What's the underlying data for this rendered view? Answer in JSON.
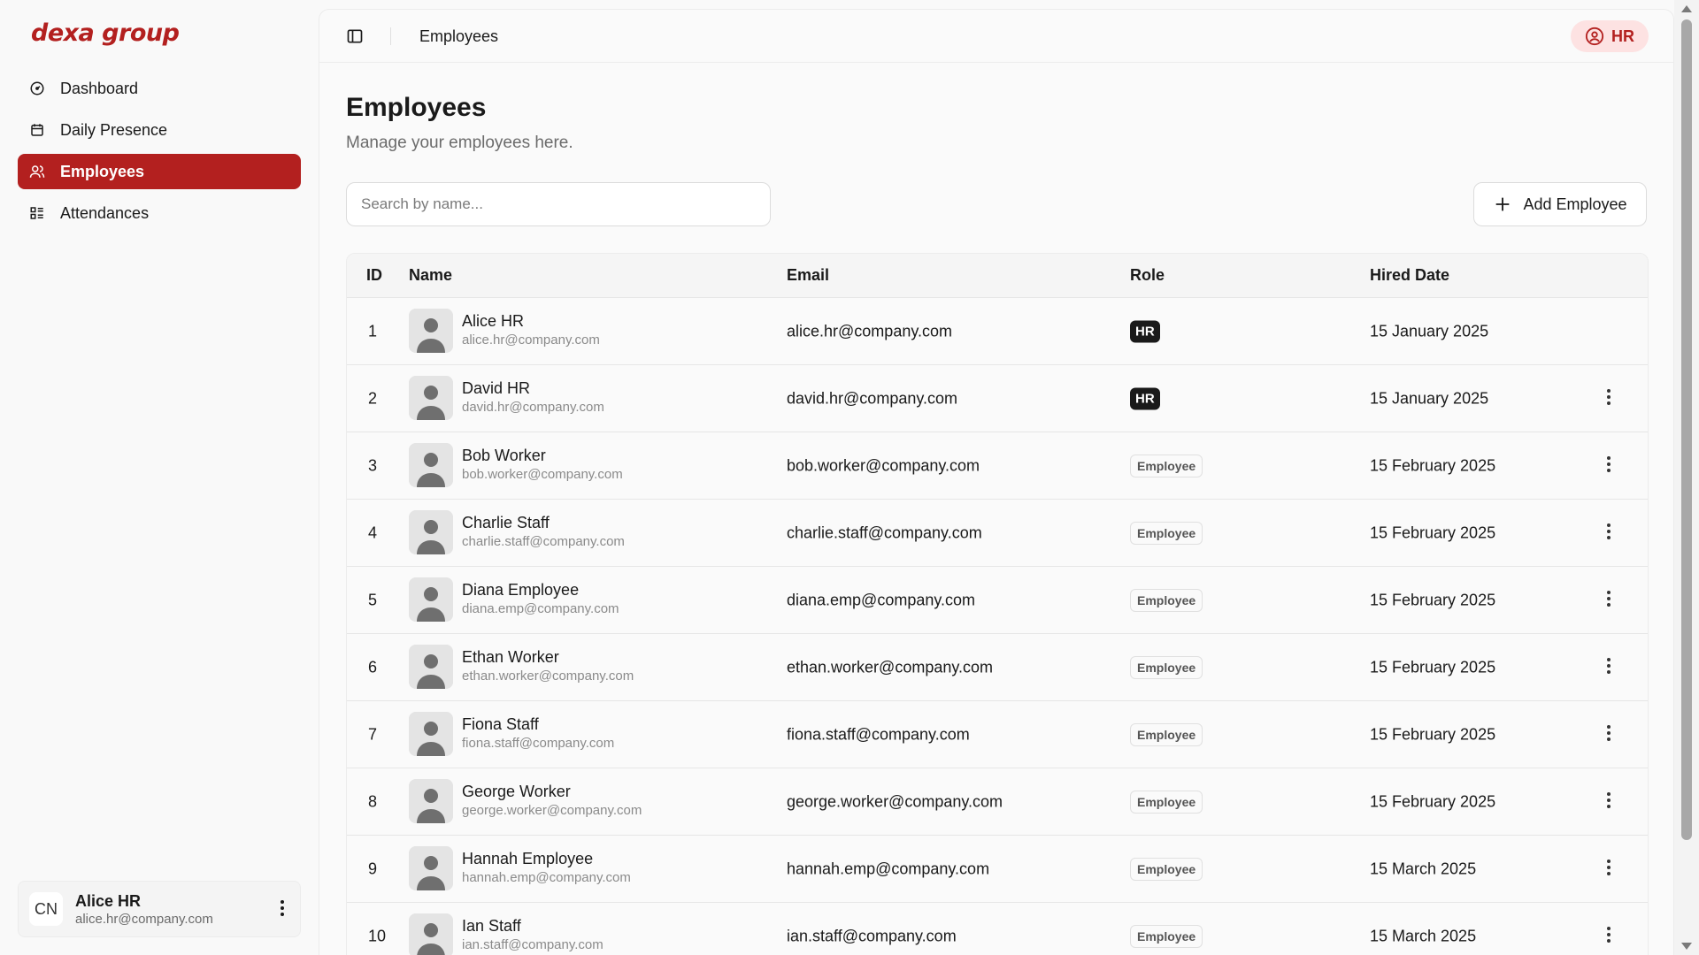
{
  "brand": {
    "logo": "dexa group",
    "accent": "#b3201f"
  },
  "sidebar": {
    "items": [
      {
        "label": "Dashboard",
        "icon": "dashboard-icon",
        "active": false
      },
      {
        "label": "Daily Presence",
        "icon": "calendar-icon",
        "active": false
      },
      {
        "label": "Employees",
        "icon": "users-icon",
        "active": true
      },
      {
        "label": "Attendances",
        "icon": "list-icon",
        "active": false
      }
    ],
    "user": {
      "initials": "CN",
      "name": "Alice HR",
      "email": "alice.hr@company.com"
    }
  },
  "header": {
    "breadcrumb": "Employees",
    "role_badge": "HR"
  },
  "page": {
    "title": "Employees",
    "subtitle": "Manage your employees here.",
    "search_placeholder": "Search by name...",
    "add_button": "Add Employee"
  },
  "table": {
    "columns": [
      "ID",
      "Name",
      "Email",
      "Role",
      "Hired Date"
    ],
    "rows": [
      {
        "id": "1",
        "name": "Alice HR",
        "sub": "alice.hr@company.com",
        "email": "alice.hr@company.com",
        "role": "HR",
        "date": "15 January 2025"
      },
      {
        "id": "2",
        "name": "David HR",
        "sub": "david.hr@company.com",
        "email": "david.hr@company.com",
        "role": "HR",
        "date": "15 January 2025"
      },
      {
        "id": "3",
        "name": "Bob Worker",
        "sub": "bob.worker@company.com",
        "email": "bob.worker@company.com",
        "role": "Employee",
        "date": "15 February 2025"
      },
      {
        "id": "4",
        "name": "Charlie Staff",
        "sub": "charlie.staff@company.com",
        "email": "charlie.staff@company.com",
        "role": "Employee",
        "date": "15 February 2025"
      },
      {
        "id": "5",
        "name": "Diana Employee",
        "sub": "diana.emp@company.com",
        "email": "diana.emp@company.com",
        "role": "Employee",
        "date": "15 February 2025"
      },
      {
        "id": "6",
        "name": "Ethan Worker",
        "sub": "ethan.worker@company.com",
        "email": "ethan.worker@company.com",
        "role": "Employee",
        "date": "15 February 2025"
      },
      {
        "id": "7",
        "name": "Fiona Staff",
        "sub": "fiona.staff@company.com",
        "email": "fiona.staff@company.com",
        "role": "Employee",
        "date": "15 February 2025"
      },
      {
        "id": "8",
        "name": "George Worker",
        "sub": "george.worker@company.com",
        "email": "george.worker@company.com",
        "role": "Employee",
        "date": "15 February 2025"
      },
      {
        "id": "9",
        "name": "Hannah Employee",
        "sub": "hannah.emp@company.com",
        "email": "hannah.emp@company.com",
        "role": "Employee",
        "date": "15 March 2025"
      },
      {
        "id": "10",
        "name": "Ian Staff",
        "sub": "ian.staff@company.com",
        "email": "ian.staff@company.com",
        "role": "Employee",
        "date": "15 March 2025"
      }
    ]
  }
}
